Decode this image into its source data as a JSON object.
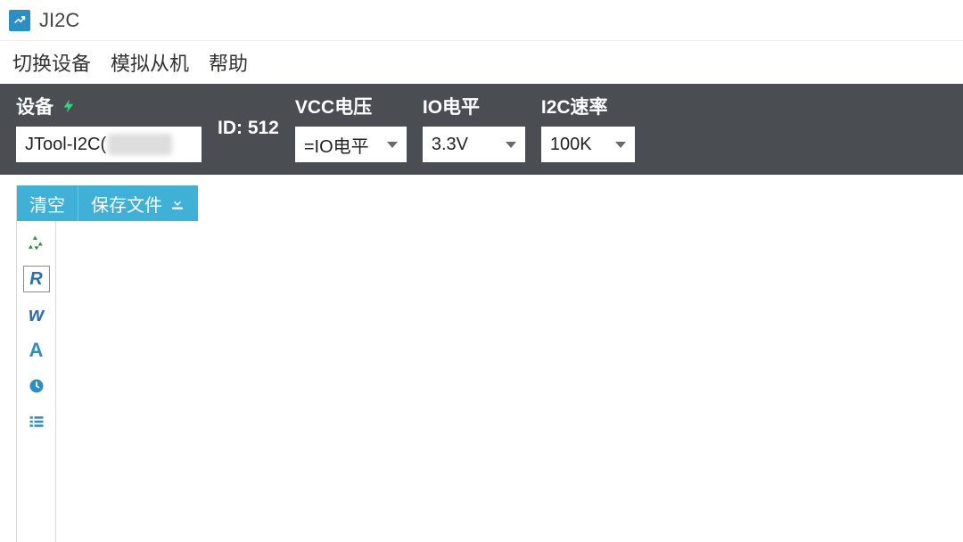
{
  "window": {
    "title": "JI2C"
  },
  "menu": {
    "switch_device": "切换设备",
    "simulate_slave": "模拟从机",
    "help": "帮助"
  },
  "settings": {
    "device_label": "设备",
    "device_value": "JTool-I2C(",
    "id_label": "ID: 512",
    "vcc_label": "VCC电压",
    "vcc_value": "=IO电平",
    "io_label": "IO电平",
    "io_value": "3.3V",
    "rate_label": "I2C速率",
    "rate_value": "100K"
  },
  "tabs": {
    "clear": "清空",
    "save_file": "保存文件"
  },
  "tools": {
    "recycle": "♻",
    "r": "R",
    "w": "w",
    "a": "A",
    "clock": "clock-icon",
    "list": "list-icon"
  }
}
